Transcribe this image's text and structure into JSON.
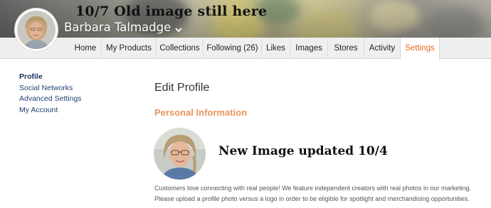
{
  "banner": {
    "note": "10/7 Old image still here",
    "user_name": "Barbara Talmadge"
  },
  "nav": {
    "tabs": [
      {
        "label": "Home"
      },
      {
        "label": "My Products"
      },
      {
        "label": "Collections"
      },
      {
        "label": "Following (26)"
      },
      {
        "label": "Likes"
      },
      {
        "label": "Images"
      },
      {
        "label": "Stores"
      },
      {
        "label": "Activity"
      },
      {
        "label": "Settings",
        "active": true
      }
    ]
  },
  "sidebar": {
    "items": [
      {
        "label": "Profile",
        "active": true
      },
      {
        "label": "Social Networks"
      },
      {
        "label": "Advanced Settings"
      },
      {
        "label": "My Account"
      }
    ]
  },
  "main": {
    "title": "Edit Profile",
    "section": "Personal Information",
    "image_note": "New Image updated 10/4",
    "helper_line1": "Customers love connecting with real people! We feature independent creators with real photos in our marketing.",
    "helper_line2": "Please upload a profile photo versus a logo in order to be eligible for spotlight and merchandising opportunities."
  },
  "colors": {
    "active_tab": "#e06a1b",
    "section_title": "#e8955a",
    "sidebar_link": "#1f3f73",
    "nav_bg": "#efefef"
  },
  "icons": {
    "user_menu": "chevron-down-icon"
  }
}
